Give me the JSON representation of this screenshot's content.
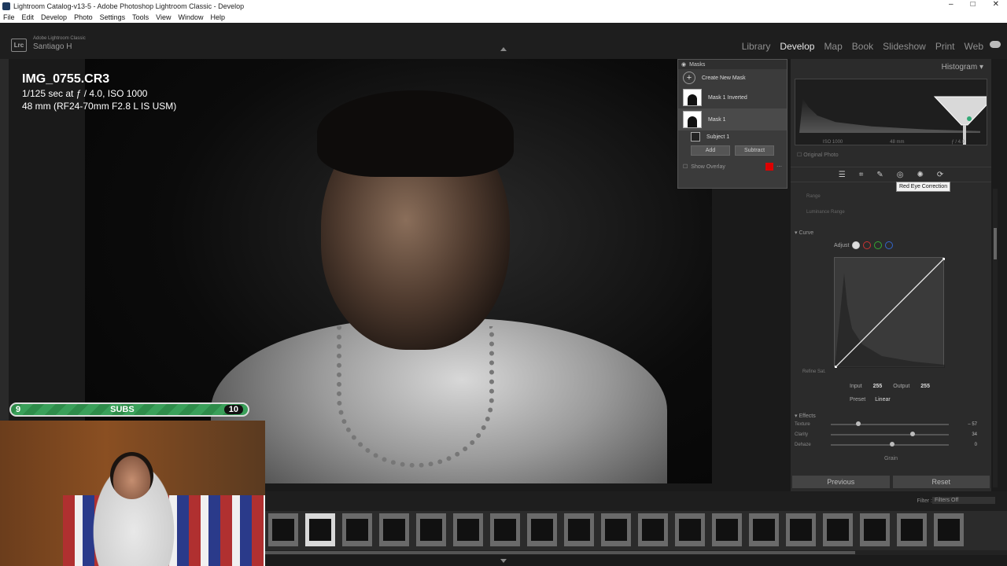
{
  "window": {
    "title": "Lightroom Catalog-v13-5 - Adobe Photoshop Lightroom Classic - Develop",
    "controls": [
      "–",
      "□",
      "✕"
    ]
  },
  "menu": [
    "File",
    "Edit",
    "Develop",
    "Photo",
    "Settings",
    "Tools",
    "View",
    "Window",
    "Help"
  ],
  "identity": {
    "logo": "Lrc",
    "product": "Adobe Lightroom Classic",
    "user": "Santiago H"
  },
  "modules": [
    "Library",
    "Develop",
    "Map",
    "Book",
    "Slideshow",
    "Print",
    "Web"
  ],
  "active_module": "Develop",
  "photo_info": {
    "filename": "IMG_0755.CR3",
    "exposure": "1/125 sec at ƒ / 4.0, ISO 1000",
    "lens": "48 mm (RF24-70mm F2.8 L IS USM)"
  },
  "masks": {
    "title": "Masks",
    "create_label": "Create New Mask",
    "items": [
      {
        "label": "Mask 1 Inverted"
      },
      {
        "label": "Mask 1"
      }
    ],
    "component_label": "Subject 1",
    "add_label": "Add",
    "subtract_label": "Subtract",
    "overlay_label": "Show Overlay",
    "overlay_color": "#d00000"
  },
  "histogram": {
    "label": "Histogram",
    "readout": [
      "ISO 1000",
      "48 mm",
      "ƒ / 4.0"
    ],
    "original_photo_label": "Original Photo"
  },
  "tools": {
    "icons": [
      "edit-sliders-icon",
      "crop-icon",
      "heal-icon",
      "red-eye-icon",
      "mask-icon",
      "presets-icon"
    ],
    "tooltip": "Red Eye Correction"
  },
  "partial_panel": {
    "range_label": "Range",
    "invert_label": "Luminance Range"
  },
  "curve": {
    "section_label": "Curve",
    "adjust_label": "Adjust",
    "refine_label": "Refine Sat.",
    "input_label": "Input",
    "input_value": "255",
    "output_label": "Output",
    "output_value": "255",
    "point_label": "Preset",
    "point_value": "Linear"
  },
  "effects": {
    "section_label": "Effects",
    "sliders": [
      {
        "label": "Texture",
        "value": "– 57",
        "position": 0.21
      },
      {
        "label": "Clarity",
        "value": "34",
        "position": 0.67
      },
      {
        "label": "Dehaze",
        "value": "0",
        "position": 0.5
      }
    ],
    "grain_label": "Grain"
  },
  "buttons": {
    "previous": "Previous",
    "reset": "Reset"
  },
  "filmstrip": {
    "filter_label": "Filter :",
    "filter_value": "Filters Off",
    "frame_count": 19,
    "selected_index": 1
  },
  "overlay": {
    "subs_left": "9",
    "subs_label": "SUBS",
    "subs_right": "10"
  }
}
